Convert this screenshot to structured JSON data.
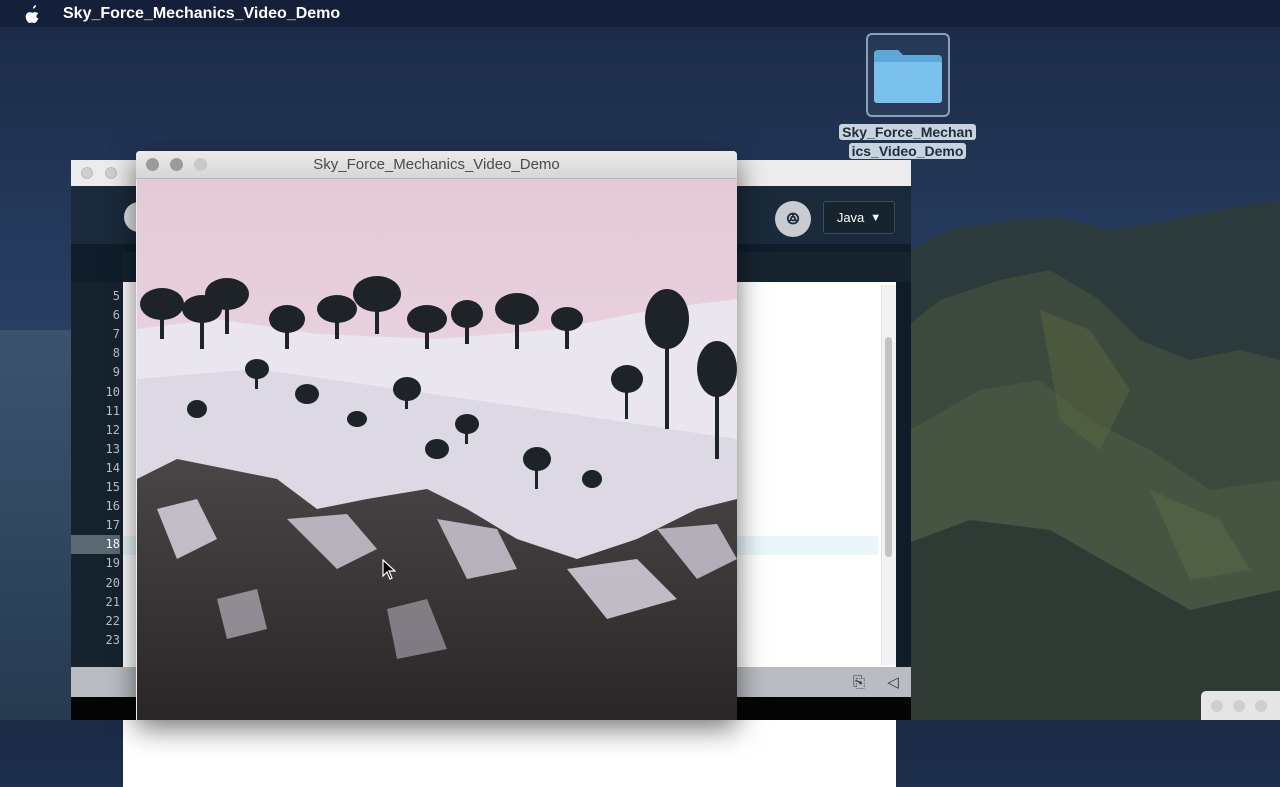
{
  "menubar": {
    "apple_icon": "apple-logo-icon",
    "app_name": "Sky_Force_Mechanics_Video_Demo"
  },
  "desktop": {
    "folder": {
      "icon": "folder-icon",
      "label_line1": "Sky_Force_Mechan",
      "label_line2": "ics_Video_Demo"
    }
  },
  "ide": {
    "mode_label": "Java",
    "mode_arrow": "▼",
    "logo_icon": "processing-logo-icon",
    "line_numbers": [
      "5",
      "6",
      "7",
      "8",
      "9",
      "10",
      "11",
      "12",
      "13",
      "14",
      "15",
      "16",
      "17",
      "18",
      "19",
      "20",
      "21",
      "22",
      "23"
    ],
    "active_line": "18",
    "footer_icons": [
      "copy-icon",
      "console-collapse-icon"
    ]
  },
  "sketch": {
    "title": "Sky_Force_Mechanics_Video_Demo",
    "scene": "snowy-cliff-with-pine-trees"
  },
  "colors": {
    "menubar": "#14203a",
    "ide_dark": "#0f1d2b",
    "sky_pink": "#e7cfd8",
    "active_line_bg": "#5a6872"
  }
}
